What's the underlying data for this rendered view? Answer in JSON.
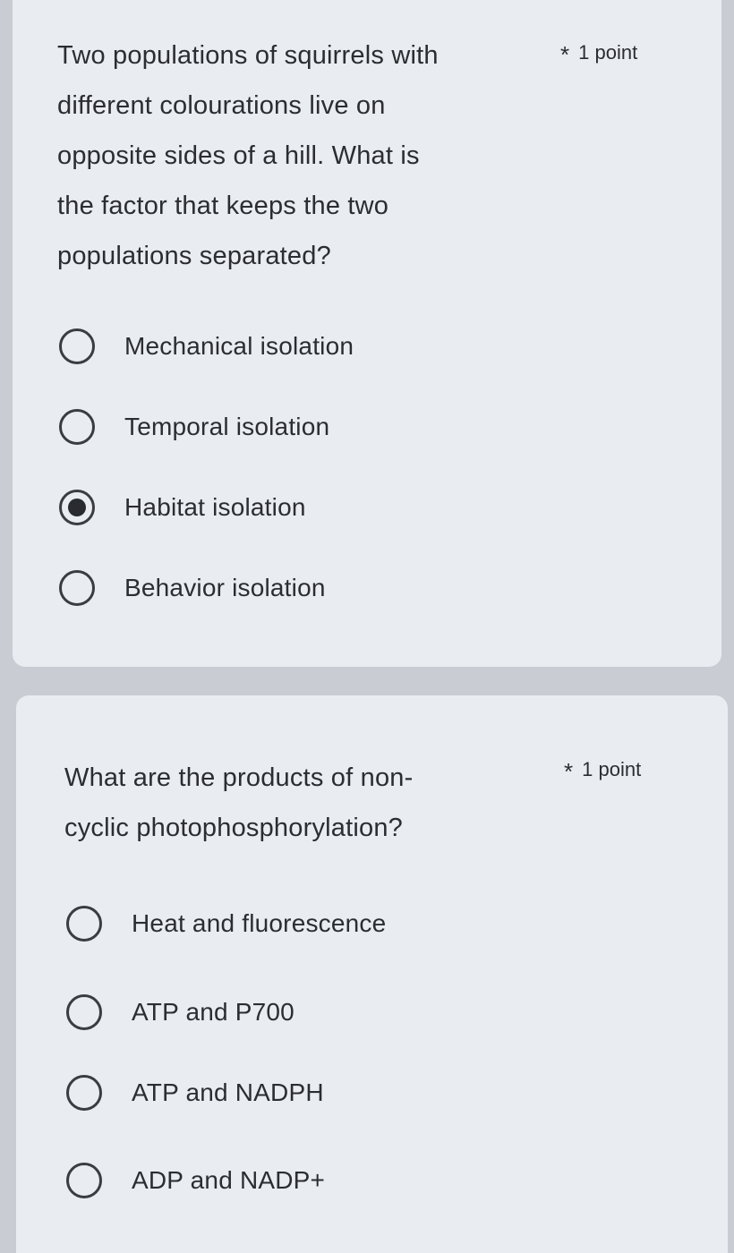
{
  "questions": [
    {
      "lines": [
        "Two populations of squirrels with",
        "different colourations live on",
        "opposite sides of a hill. What is",
        "the factor that keeps the two",
        "populations separated?"
      ],
      "required_marker": "*",
      "points": "1 point",
      "options": [
        {
          "label": "Mechanical isolation",
          "selected": false
        },
        {
          "label": "Temporal isolation",
          "selected": false
        },
        {
          "label": "Habitat isolation",
          "selected": true
        },
        {
          "label": "Behavior isolation",
          "selected": false
        }
      ]
    },
    {
      "lines": [
        "What are the products of non-",
        "cyclic photophosphorylation?"
      ],
      "required_marker": "*",
      "points": "1 point",
      "options": [
        {
          "label": "Heat and fluorescence",
          "selected": false
        },
        {
          "label": "ATP and P700",
          "selected": false
        },
        {
          "label": "ATP and NADPH",
          "selected": false
        },
        {
          "label": "ADP and NADP+",
          "selected": false
        }
      ]
    }
  ]
}
